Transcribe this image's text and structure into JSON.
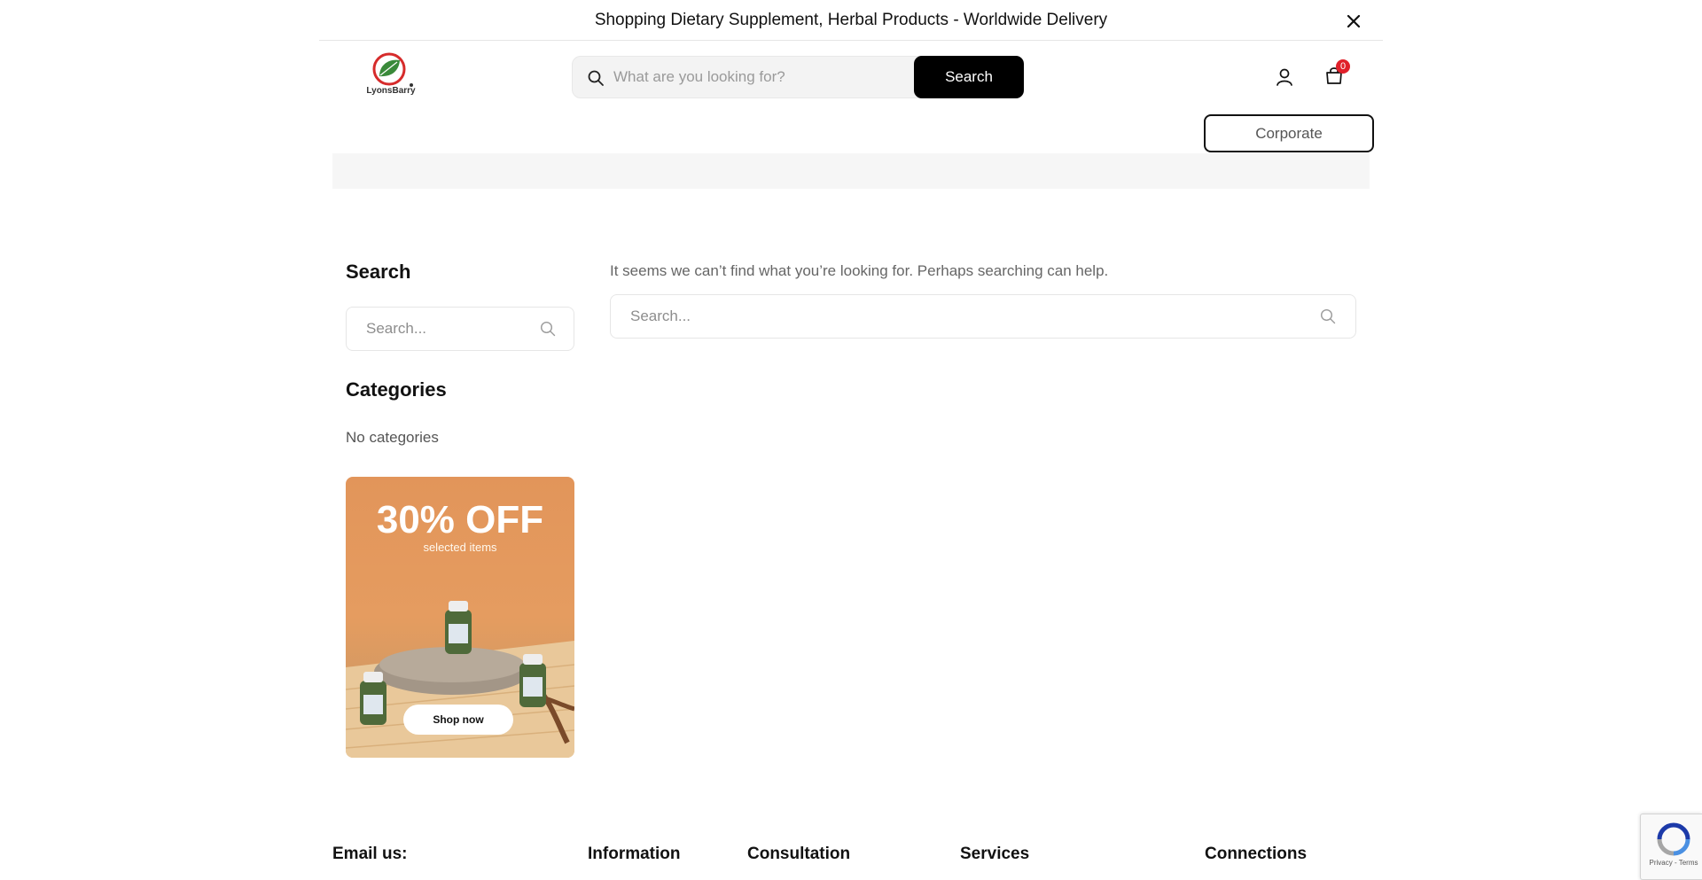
{
  "announcement": {
    "text": "Shopping Dietary Supplement, Herbal Products - Worldwide Delivery"
  },
  "header": {
    "logo_text": "LyonsBarry",
    "search": {
      "placeholder": "What are you looking for?",
      "button_label": "Search"
    },
    "cart_count": "0",
    "corporate_label": "Corporate"
  },
  "sidebar": {
    "search_heading": "Search",
    "search_placeholder": "Search...",
    "categories_heading": "Categories",
    "no_categories": "No categories",
    "promo": {
      "title": "30% OFF",
      "subtitle": "selected items",
      "button_label": "Shop now"
    }
  },
  "main": {
    "message": "It seems we can’t find what you’re looking for. Perhaps searching can help.",
    "search_placeholder": "Search..."
  },
  "footer": {
    "headings": [
      "Email us:",
      "Information",
      "Consultation",
      "Services",
      "Connections"
    ]
  },
  "recaptcha": {
    "text": "Privacy - Terms"
  },
  "colors": {
    "accent": "#000000",
    "badge": "#e0202a",
    "logo_red": "#d62b2b",
    "logo_green": "#3a8a3a"
  }
}
